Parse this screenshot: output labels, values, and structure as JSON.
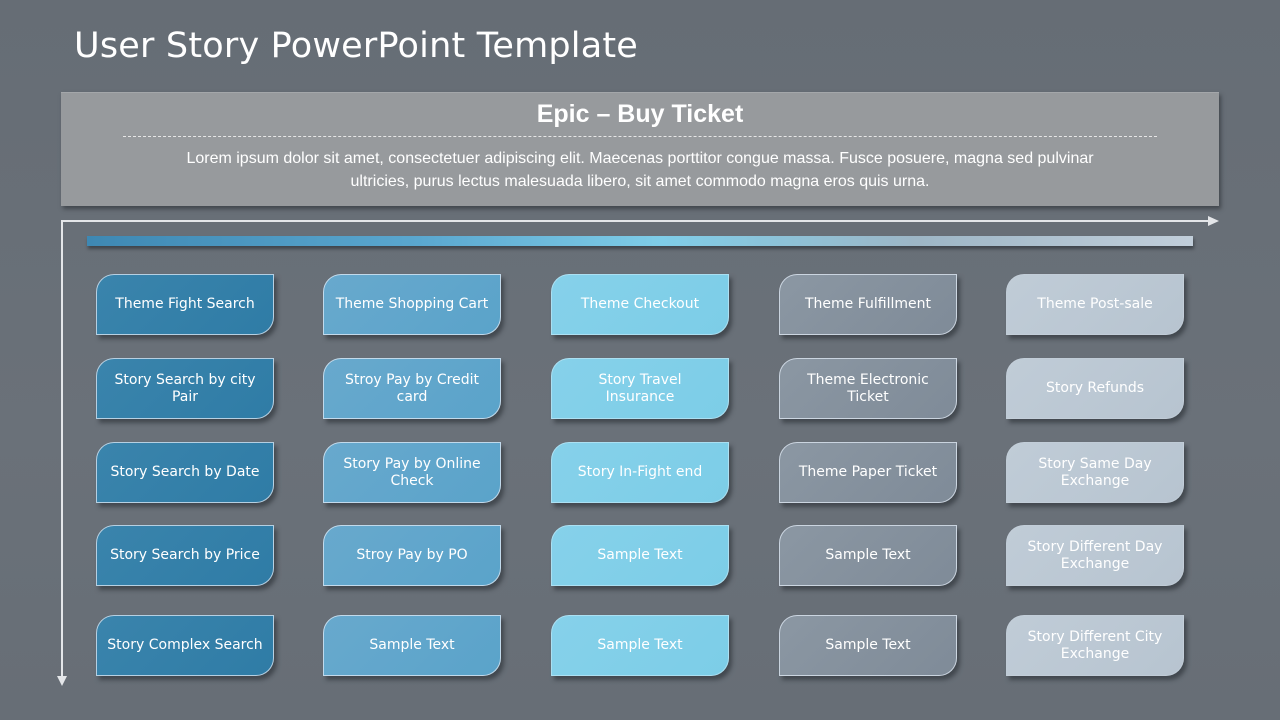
{
  "slide": {
    "title": "User Story PowerPoint Template"
  },
  "epic": {
    "title": "Epic – Buy Ticket",
    "description_line1": "Lorem ipsum dolor sit amet, consectetuer adipiscing elit.  Maecenas porttitor congue massa. Fusce posuere, magna sed pulvinar",
    "description_line2": "ultricies, purus lectus malesuada libero, sit amet commodo magna eros quis urna."
  },
  "colors": {
    "column_1": "#3a84ac",
    "column_2": "#62a6cc",
    "column_3": "#82cfe8",
    "column_4": "#86929e",
    "column_5": "#bcc8d4",
    "background": "#687078",
    "epic_box": "#979a9d"
  },
  "columns": [
    {
      "cards": [
        "Theme Fight Search",
        "Story Search by city Pair",
        "Story Search by Date",
        "Story Search by Price",
        "Story Complex Search"
      ]
    },
    {
      "cards": [
        "Theme Shopping Cart",
        "Stroy Pay by Credit card",
        "Story Pay by Online Check",
        "Stroy Pay by PO",
        "Sample Text"
      ]
    },
    {
      "cards": [
        "Theme Checkout",
        "Story Travel Insurance",
        "Story In-Fight end",
        "Sample Text",
        "Sample Text"
      ]
    },
    {
      "cards": [
        "Theme Fulfillment",
        "Theme Electronic Ticket",
        "Theme Paper Ticket",
        "Sample Text",
        "Sample Text"
      ]
    },
    {
      "cards": [
        "Theme Post-sale",
        "Story Refunds",
        "Story Same Day Exchange",
        "Story Different Day Exchange",
        "Story Different City Exchange"
      ]
    }
  ]
}
